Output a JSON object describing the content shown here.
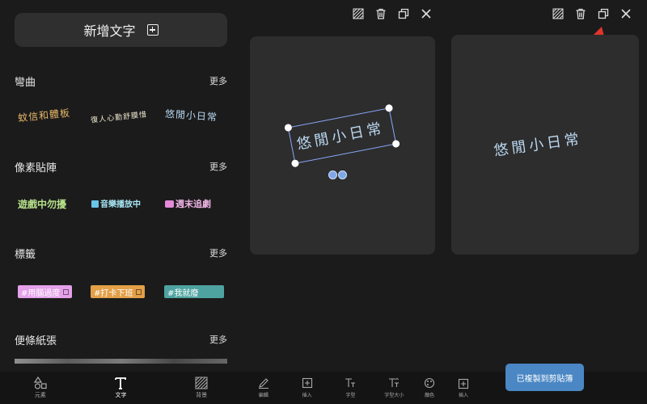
{
  "left_panel": {
    "add_text_label": "新增文字",
    "sections": [
      {
        "title": "彎曲",
        "more": "更多",
        "samples": [
          "蚊信和體板",
          "復人心勤舒膜惜",
          "悠閒小日常"
        ]
      },
      {
        "title": "像素貼陣",
        "more": "更多",
        "samples": [
          "遊戲中勿擾",
          "音樂播放中",
          "週末追劇"
        ]
      },
      {
        "title": "標籤",
        "more": "更多",
        "samples": [
          "#用腦過度",
          "#打卡下班",
          "#我就廢"
        ]
      },
      {
        "title": "便條紙張",
        "more": "更多",
        "samples": []
      }
    ],
    "bottom_tabs": [
      {
        "label": "元素",
        "icon": "shapes-icon",
        "active": false
      },
      {
        "label": "文字",
        "icon": "text-t-icon",
        "active": true
      },
      {
        "label": "背景",
        "icon": "hatch-icon",
        "active": false
      }
    ]
  },
  "middle_panel": {
    "text_element": "悠閒小日常",
    "bottom_tabs": [
      {
        "label": "編輯",
        "icon": "pencil-icon"
      },
      {
        "label": "插入",
        "icon": "insert-plus-icon"
      },
      {
        "label": "字型",
        "icon": "font-icon"
      },
      {
        "label": "字型大小",
        "icon": "font-size-icon"
      },
      {
        "label": "顏色",
        "icon": "palette-icon"
      }
    ]
  },
  "right_panel": {
    "text_element": "悠閒小日常",
    "toast": "已複製到剪貼簿",
    "bottom_tab": {
      "label": "插入",
      "icon": "insert-plus-icon"
    }
  },
  "colors": {
    "accent": "#4a87c4",
    "selection": "#8aa9ff",
    "arrow": "#e0352b",
    "handwriting": "#b9d7f0"
  }
}
